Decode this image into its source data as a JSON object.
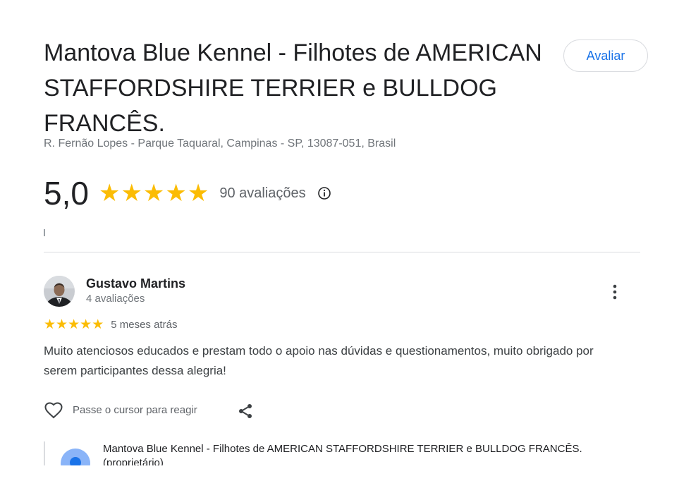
{
  "business": {
    "title": "Mantova Blue Kennel - Filhotes de AMERICAN STAFFORDSHIRE TERRIER e BULLDOG FRANCÊS.",
    "address": "R. Fernão Lopes - Parque Taquaral, Campinas - SP, 13087-051, Brasil",
    "rate_button_label": "Avaliar"
  },
  "rating": {
    "value_text": "5,0",
    "stars": 5,
    "review_count_text": "90 avaliações"
  },
  "review": {
    "reviewer_name": "Gustavo Martins",
    "reviewer_review_count": "4 avaliações",
    "stars": 5,
    "time_ago": "5 meses atrás",
    "text": "Muito atenciosos educados e prestam todo o apoio nas dúvidas e questionamentos, muito obrigado por serem participantes dessa alegria!",
    "react_hint": "Passe o cursor para reagir",
    "owner_reply_name": "Mantova Blue Kennel - Filhotes de AMERICAN STAFFORDSHIRE TERRIER e BULLDOG FRANCÊS. (proprietário)"
  },
  "icons": {
    "star": "star-icon",
    "info": "info-icon",
    "more": "more-vert-icon",
    "like": "heart-outline-icon",
    "share": "share-icon",
    "avatar": "user-avatar",
    "owner_avatar": "owner-avatar"
  },
  "colors": {
    "star": "#fbbc04",
    "link_blue": "#1a73e8",
    "text_primary": "#202124",
    "text_secondary": "#70757a",
    "divider": "#dadce0"
  }
}
